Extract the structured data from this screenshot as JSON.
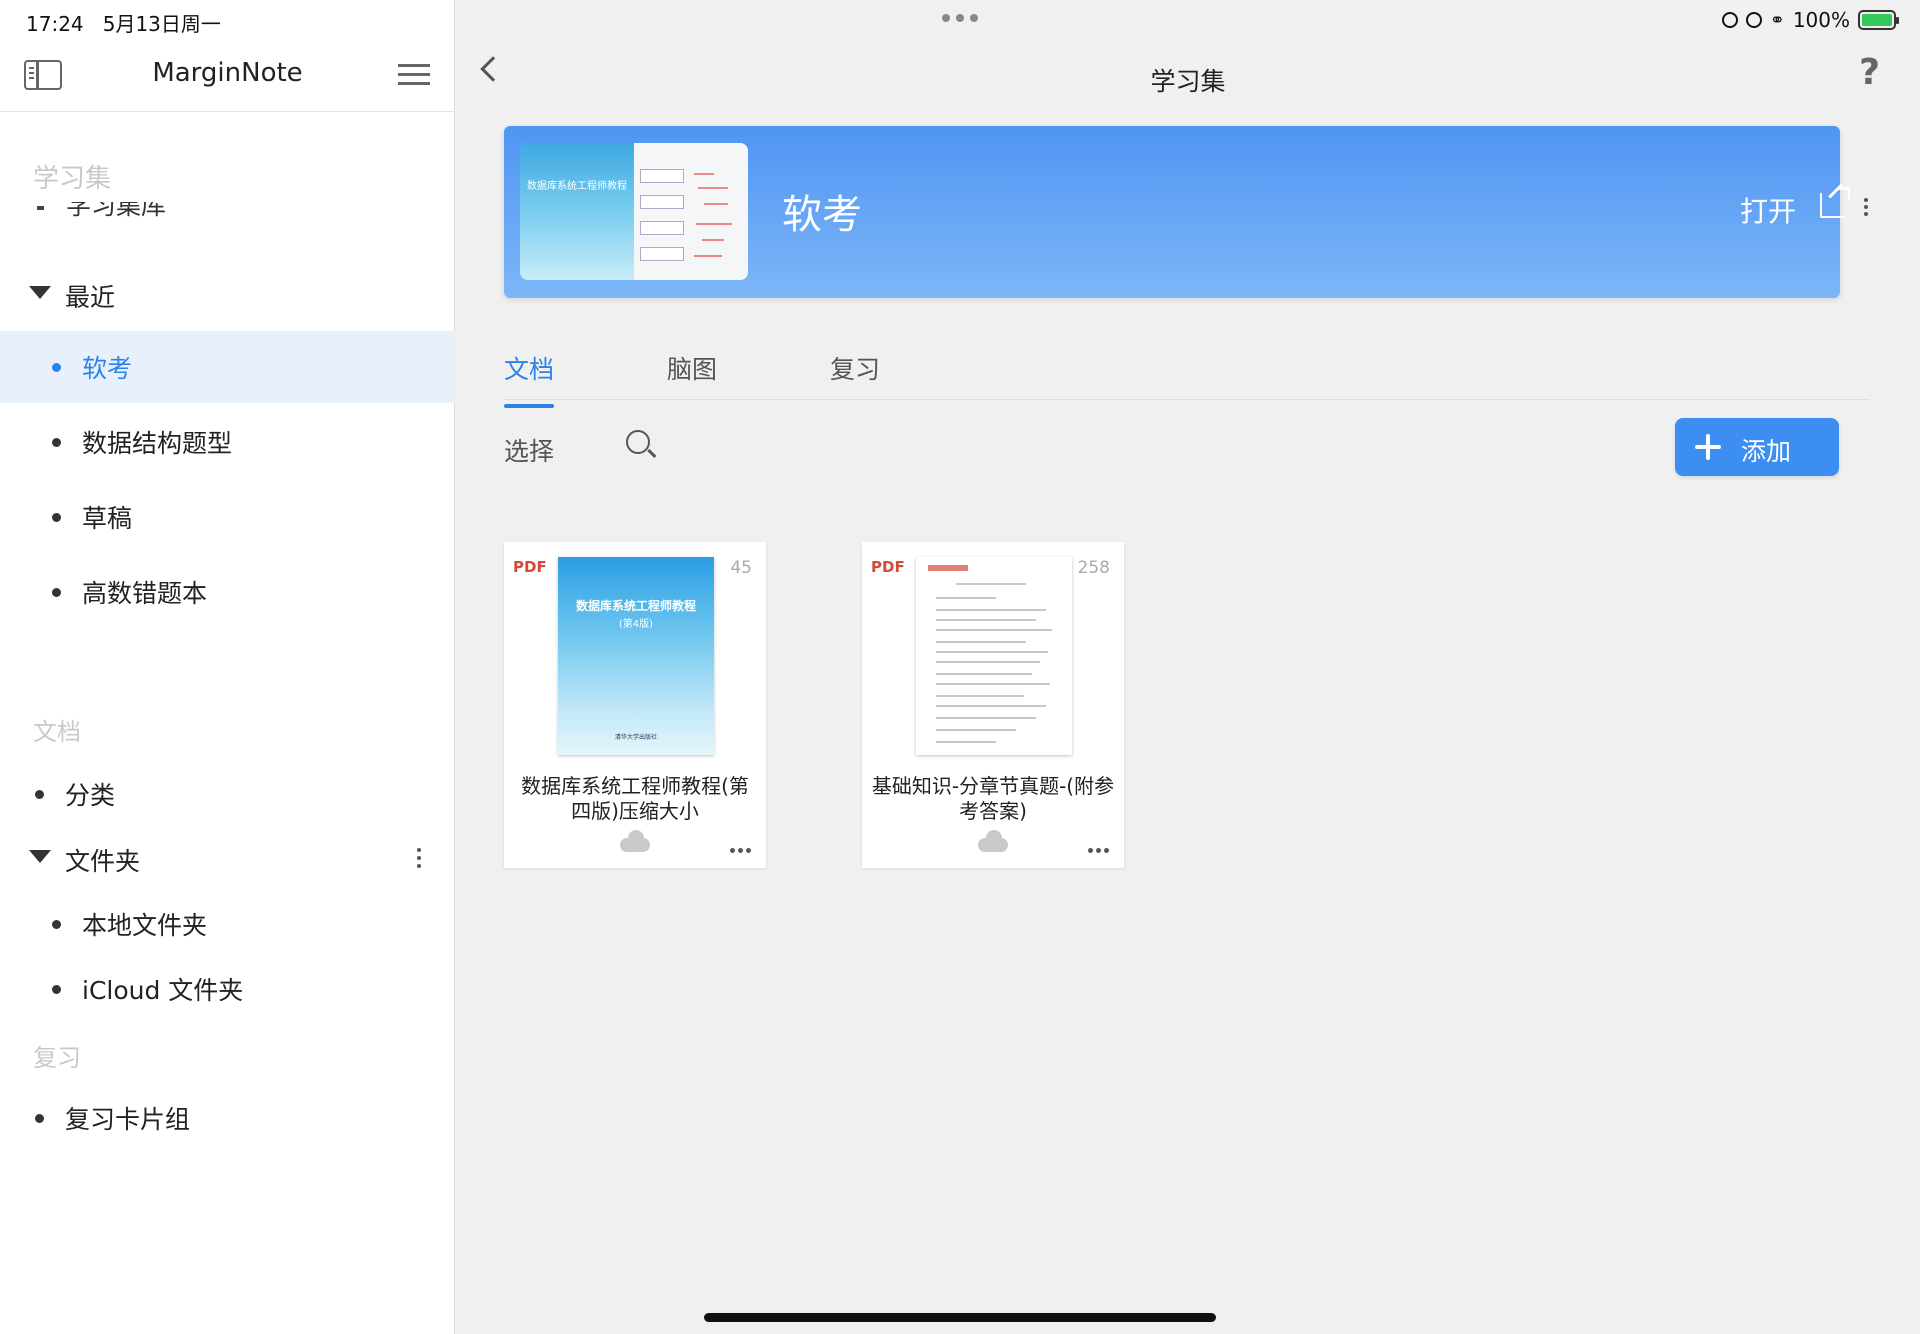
{
  "status_bar": {
    "time": "17:24",
    "date": "5月13日周一",
    "battery": "100%"
  },
  "sidebar": {
    "app_title": "MarginNote",
    "sections": {
      "study_sets": "学习集",
      "clipped_item": "学习集库",
      "recent": "最近",
      "documents": "文档",
      "review": "复习"
    },
    "recent_items": [
      {
        "label": "软考"
      },
      {
        "label": "数据结构题型"
      },
      {
        "label": "草稿"
      },
      {
        "label": "高数错题本"
      }
    ],
    "doc_items": {
      "category": "分类",
      "folders": "文件夹",
      "local_folder": "本地文件夹",
      "icloud_folder": "iCloud 文件夹"
    },
    "review_items": {
      "card_decks": "复习卡片组"
    }
  },
  "main": {
    "nav_title": "学习集",
    "help": "?",
    "banner": {
      "title": "软考",
      "open_label": "打开",
      "thumb_title": "数据库系统工程师教程"
    },
    "tabs": [
      {
        "label": "文档"
      },
      {
        "label": "脑图"
      },
      {
        "label": "复习"
      }
    ],
    "toolbar": {
      "select_label": "选择",
      "add_label": "添加"
    },
    "documents": [
      {
        "type": "PDF",
        "pages": "45",
        "name": "数据库系统工程师教程(第四版)压缩大小",
        "cover_title": "数据库系统工程师教程",
        "cover_subtitle": "(第4版)",
        "cover_publisher": "清华大学出版社"
      },
      {
        "type": "PDF",
        "pages": "258",
        "name": "基础知识-分章节真题-(附参考答案)"
      }
    ]
  },
  "colors": {
    "accent": "#2c84e8",
    "banner_top": "#4f95f3",
    "banner_bottom": "#7db6f8",
    "pdf_tag": "#d34a3a"
  }
}
